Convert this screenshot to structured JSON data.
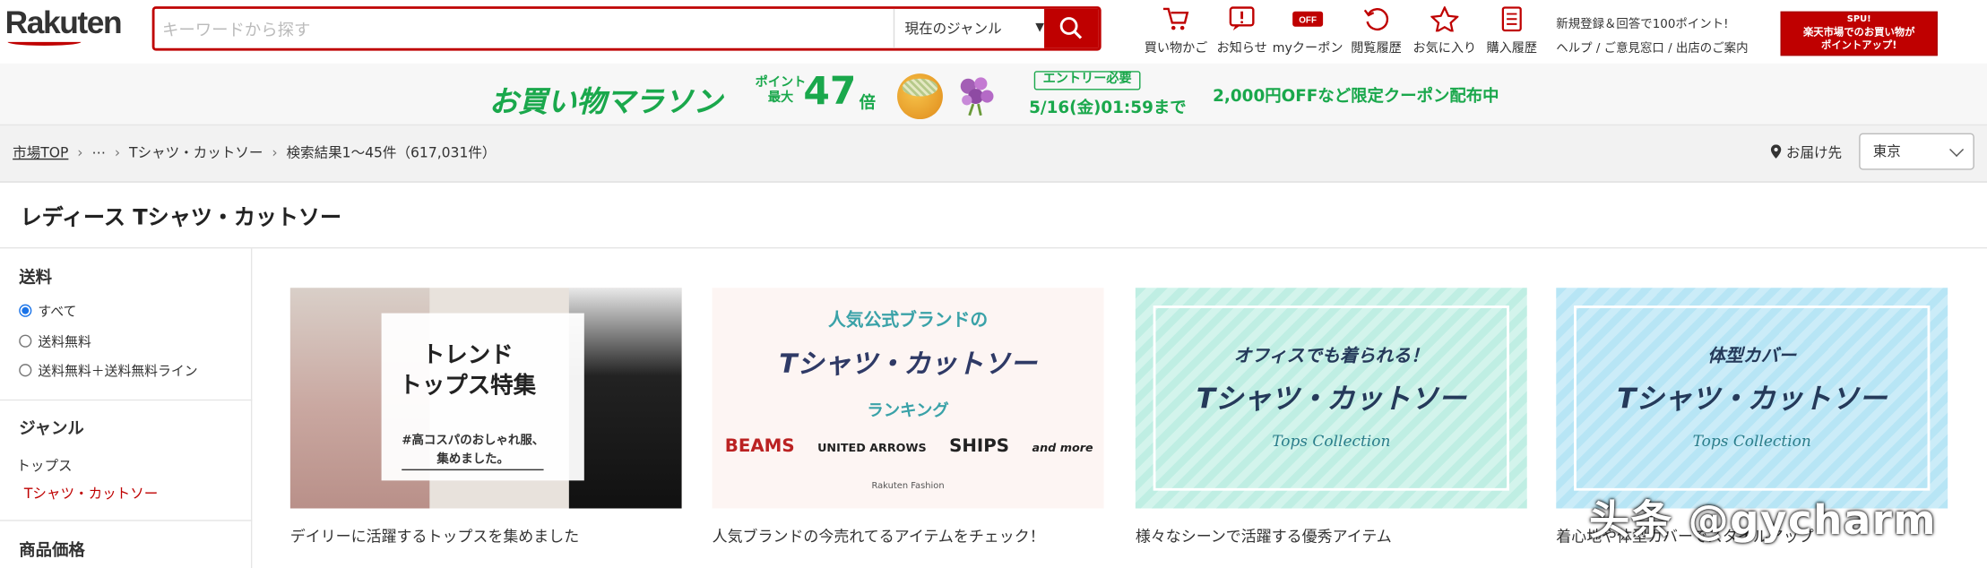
{
  "header": {
    "logo": "Rakuten",
    "search": {
      "placeholder": "キーワードから探す",
      "genre": "現在のジャンル"
    },
    "icons": [
      {
        "label": "買い物かご",
        "icon": "cart-icon"
      },
      {
        "label": "お知らせ",
        "icon": "notice-icon"
      },
      {
        "label": "myクーポン",
        "icon": "coupon-icon"
      },
      {
        "label": "閲覧履歴",
        "icon": "history-icon"
      },
      {
        "label": "お気に入り",
        "icon": "star-icon"
      },
      {
        "label": "購入履歴",
        "icon": "purchase-history-icon"
      }
    ],
    "links_line1": "新規登録＆回答で100ポイント!",
    "links_line2": [
      "ヘルプ",
      "ご意見窓口",
      "出店のご案内"
    ],
    "spu": {
      "top": "SPU!",
      "line1": "楽天市場でのお買い物が",
      "line2": "ポイントアップ!"
    }
  },
  "banner": {
    "title": "お買い物マラソン",
    "point_label": [
      "ポイント",
      "最大"
    ],
    "multiplier": "47",
    "multiplier_unit": "倍",
    "entry": "エントリー必要",
    "deadline": "5/16(金)01:59まで",
    "coupon": "2,000円OFFなど限定クーポン配布中"
  },
  "breadcrumb": {
    "items": [
      "市場TOP",
      "⋯",
      "Tシャツ・カットソー",
      "検索結果1～45件（617,031件）"
    ],
    "deliver_label": "お届け先",
    "deliver_value": "東京"
  },
  "page_title": "レディース Tシャツ・カットソー",
  "sidebar": {
    "shipping_title": "送料",
    "shipping_options": [
      "すべて",
      "送料無料",
      "送料無料＋送料無料ライン"
    ],
    "genre_title": "ジャンル",
    "genre_parent": "トップス",
    "genre_current": "Tシャツ・カットソー",
    "price_title": "商品価格"
  },
  "cards": [
    {
      "img_title": [
        "トレンド",
        "トップス特集"
      ],
      "img_sub": [
        "#高コスパのおしゃれ服、",
        "集めました。"
      ],
      "caption": "デイリーに活躍するトップスを集めました"
    },
    {
      "img_head": "人気公式ブランドの",
      "img_main": "Tシャツ・カットソー",
      "img_rank": "ランキング",
      "brands": [
        "BEAMS",
        "UNITED ARROWS",
        "SHIPS",
        "and more"
      ],
      "img_foot": "Rakuten Fashion",
      "caption": "人気ブランドの今売れてるアイテムをチェック！"
    },
    {
      "img_head": "オフィスでも着られる！",
      "img_main": "Tシャツ・カットソー",
      "img_sub": "Tops Collection",
      "caption": "様々なシーンで活躍する優秀アイテム"
    },
    {
      "img_head": "体型カバー",
      "img_main": "Tシャツ・カットソー",
      "img_sub": "Tops Collection",
      "caption": "着心地や体型カバーでスタイルアップ"
    }
  ],
  "watermark": "头条 @gycharm",
  "colors": {
    "brand": "#bf0000",
    "marathon": "#1aa84c"
  }
}
